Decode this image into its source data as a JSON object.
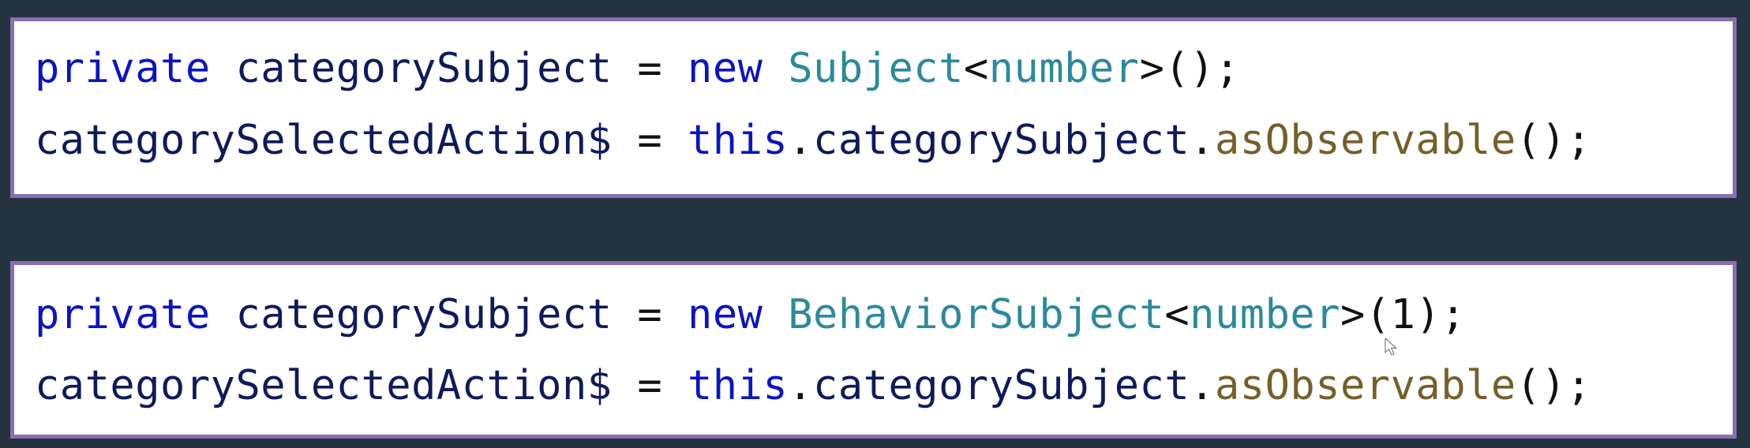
{
  "snippets": [
    {
      "lines": [
        {
          "kw_private": "private",
          "field": "categorySubject",
          "assign": "=",
          "kw_new": "new",
          "type": "Subject",
          "generic_open": "<",
          "generic_type": "number",
          "generic_close": ">",
          "call": "();"
        },
        {
          "field": "categorySelectedAction$",
          "assign": "=",
          "kw_this": "this",
          "dot1": ".",
          "member": "categorySubject",
          "dot2": ".",
          "method": "asObservable",
          "call": "();"
        }
      ]
    },
    {
      "lines": [
        {
          "kw_private": "private",
          "field": "categorySubject",
          "assign": "=",
          "kw_new": "new",
          "type": "BehaviorSubject",
          "generic_open": "<",
          "generic_type": "number",
          "generic_close": ">",
          "paren_open": "(",
          "arg": "1",
          "call_close": ");"
        },
        {
          "field": "categorySelectedAction$",
          "assign": "=",
          "kw_this": "this",
          "dot1": ".",
          "member": "categorySubject",
          "dot2": ".",
          "method": "asObservable",
          "call": "();"
        }
      ]
    }
  ],
  "colors": {
    "background": "#263340",
    "box_border": "#8a6fb0",
    "keyword": "#0a14c4",
    "identifier": "#0e1a5c",
    "type": "#2b8a9b",
    "method": "#75602a"
  },
  "cursor": {
    "icon": "mouse-pointer-icon"
  }
}
